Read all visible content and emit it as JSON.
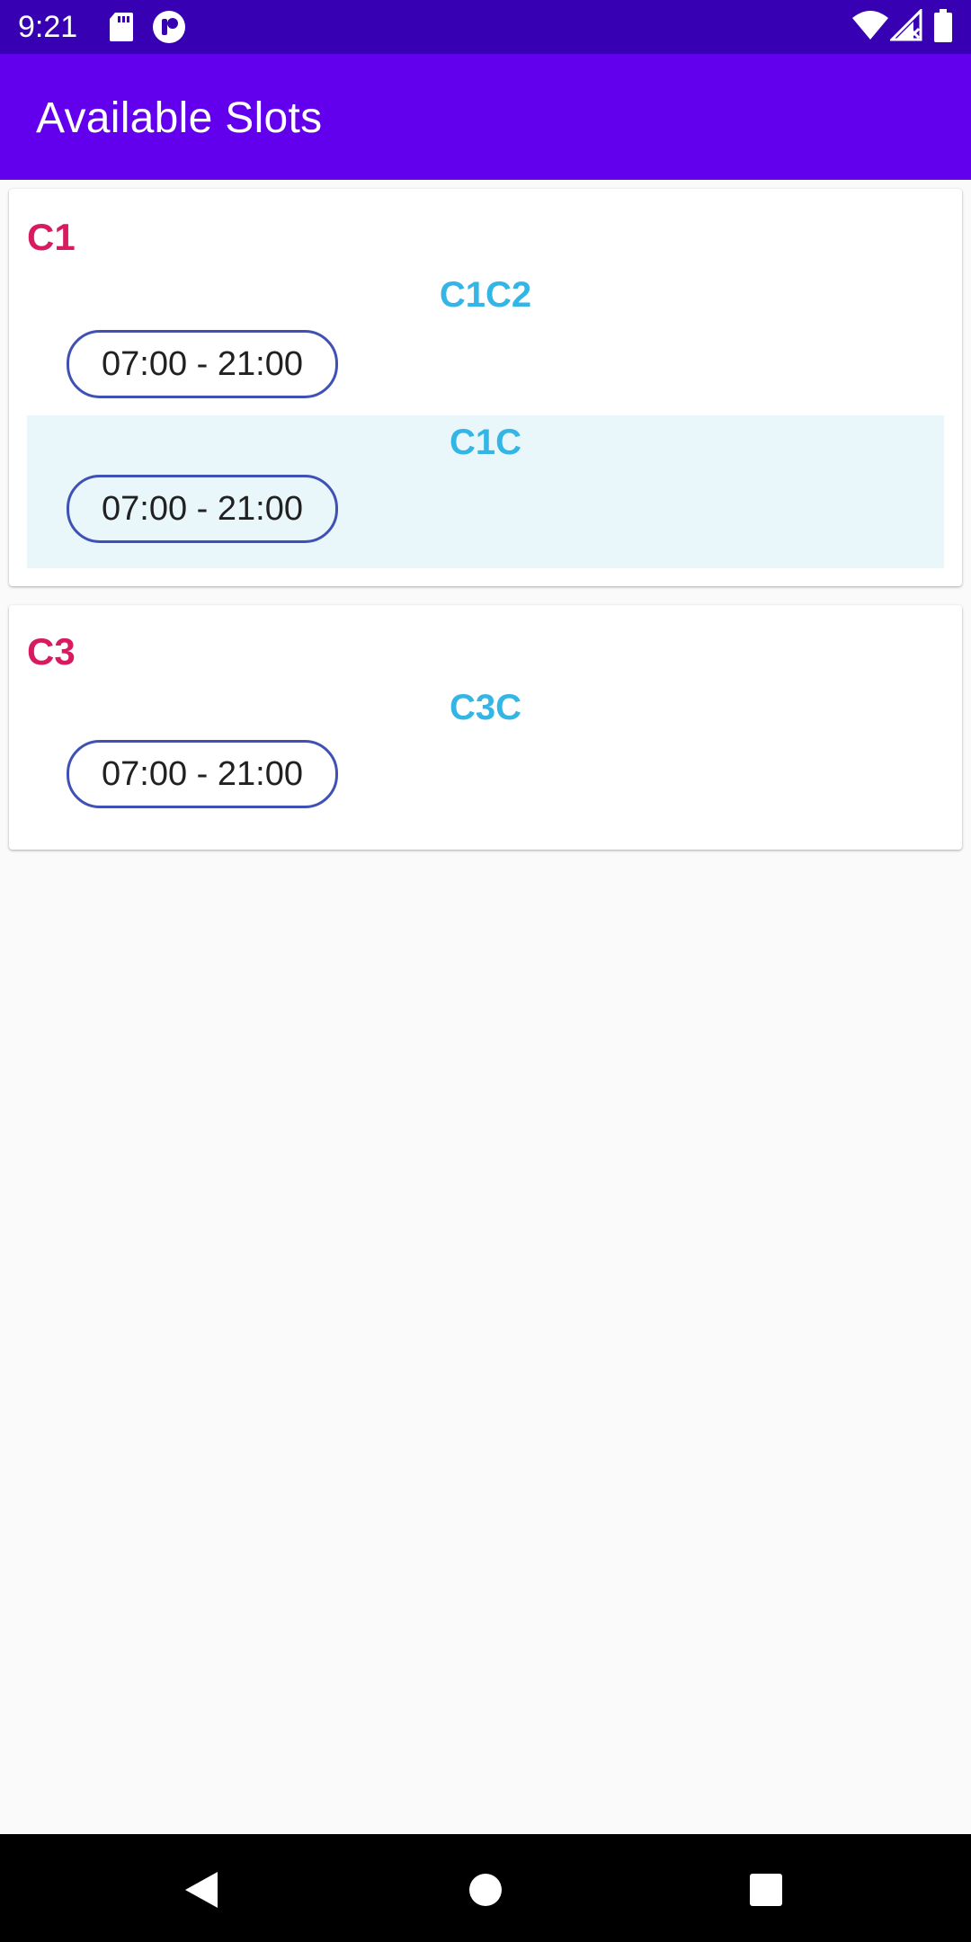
{
  "status_bar": {
    "time": "9:21",
    "icons": [
      "sd-card-icon",
      "app-notification-icon",
      "wifi-icon",
      "signal-icon",
      "battery-icon"
    ]
  },
  "app_bar": {
    "title": "Available Slots"
  },
  "cards": [
    {
      "title": "C1",
      "sections": [
        {
          "title": "C1C2",
          "slots": [
            "07:00 - 21:00"
          ],
          "highlighted": false
        },
        {
          "title": "C1C",
          "slots": [
            "07:00 - 21:00"
          ],
          "highlighted": true
        }
      ]
    },
    {
      "title": "C3",
      "sections": [
        {
          "title": "C3C",
          "slots": [
            "07:00 - 21:00"
          ],
          "highlighted": false
        }
      ]
    }
  ],
  "nav_bar": {
    "icons": [
      "back-icon",
      "home-icon",
      "recents-icon"
    ]
  },
  "colors": {
    "status_bar": "#3700b3",
    "app_bar": "#6200ee",
    "card_title": "#d81b60",
    "section_title": "#33b5e5",
    "chip_border": "#3f51b5",
    "highlight": "#e9f7fb"
  }
}
